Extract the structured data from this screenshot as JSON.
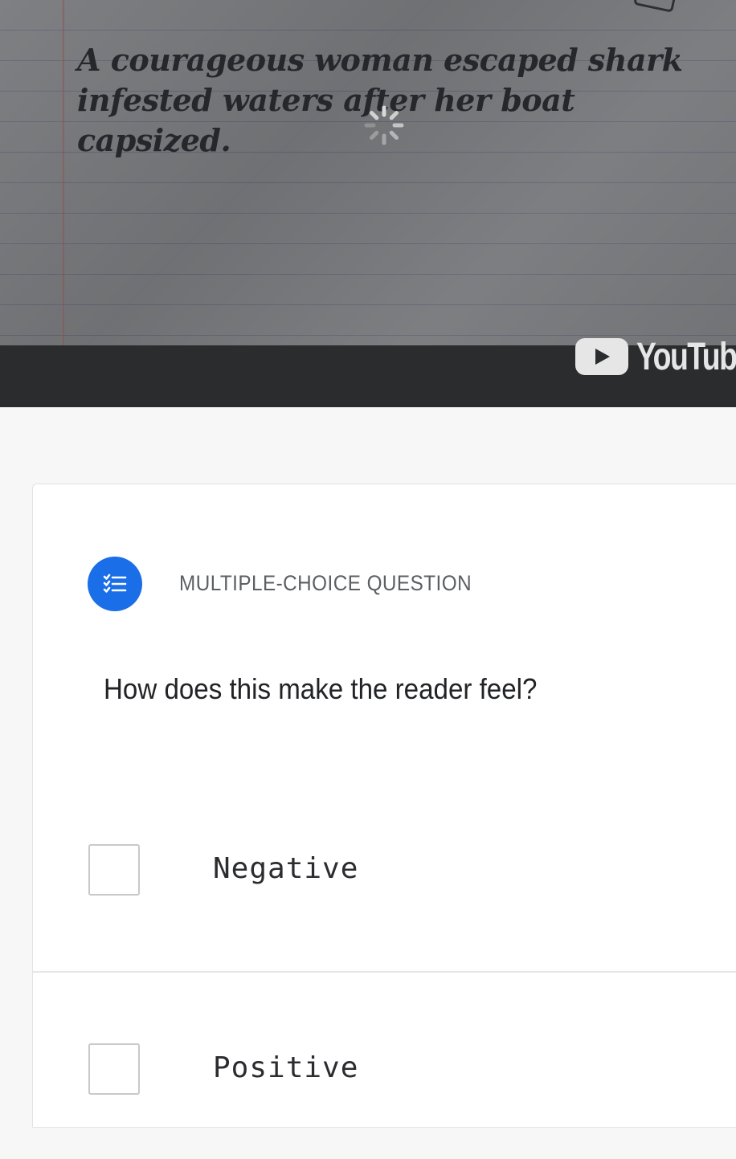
{
  "video": {
    "caption": "A courageous woman escaped shark infested waters after her boat capsized.",
    "logo_text": "YouTube",
    "loading": true
  },
  "question": {
    "type_icon": "checklist-icon",
    "type_label": "MULTIPLE-CHOICE QUESTION",
    "prompt": "How does this make the reader feel?",
    "options": [
      {
        "label": "Negative",
        "checked": false
      },
      {
        "label": "Positive",
        "checked": false
      }
    ]
  },
  "colors": {
    "accent": "#1a6ee8",
    "video_bar": "#2b2c2e",
    "page_bg": "#f7f7f7"
  }
}
